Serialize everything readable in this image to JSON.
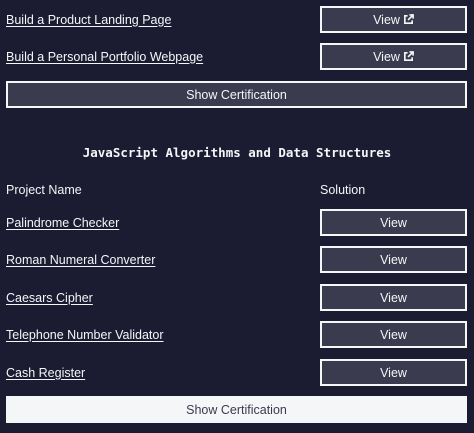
{
  "top_projects": [
    {
      "name": "Build a Product Landing Page",
      "button": "View"
    },
    {
      "name": "Build a Personal Portfolio Webpage",
      "button": "View"
    }
  ],
  "top_certification_button": "Show Certification",
  "section": {
    "title": "JavaScript Algorithms and Data Structures",
    "columns": {
      "project": "Project Name",
      "solution": "Solution"
    },
    "projects": [
      {
        "name": "Palindrome Checker",
        "button": "View"
      },
      {
        "name": "Roman Numeral Converter",
        "button": "View"
      },
      {
        "name": "Caesars Cipher",
        "button": "View"
      },
      {
        "name": "Telephone Number Validator",
        "button": "View"
      },
      {
        "name": "Cash Register",
        "button": "View"
      }
    ],
    "certification_button": "Show Certification"
  },
  "colors": {
    "background": "#1b1b32",
    "button_bg": "#3b3b4f",
    "text": "#f5f6f7"
  },
  "icons": {
    "external_link": "external-link-icon"
  }
}
